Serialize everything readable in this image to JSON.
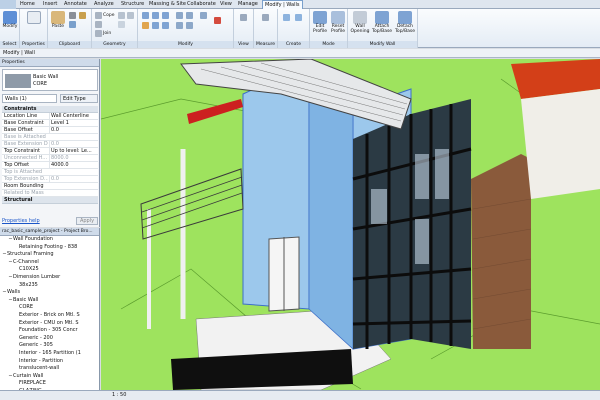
{
  "tabs": [
    "Home",
    "Insert",
    "Annotate",
    "Analyze",
    "Structure",
    "Massing & Site",
    "Collaborate",
    "View",
    "Manage",
    "Modify | Walls"
  ],
  "ribbon": {
    "panels": [
      "Select",
      "Properties",
      "Clipboard",
      "Geometry",
      "Modify",
      "View",
      "Measure",
      "Create",
      "Mode",
      "Modify Wall"
    ],
    "buttons": {
      "modify": "Modify",
      "paste": "Paste",
      "cut_tip": "Cope",
      "join": "Join",
      "edit_profile": "Edit Profile",
      "reset_profile": "Reset Profile",
      "wall_opening": "Wall Opening",
      "attach": "Attach Top/Base",
      "detach": "Detach Top/Base"
    }
  },
  "options_bar": "Modify | Wall",
  "properties": {
    "title": "Properties",
    "type_family": "Basic Wall",
    "type_name": "CORE",
    "selection_filter": "Walls (1)",
    "edit_type": "Edit Type",
    "groups": {
      "constraints": "Constraints",
      "structural": "Structural"
    },
    "rows": [
      {
        "k": "Location Line",
        "v": "Wall Centerline",
        "dim": false
      },
      {
        "k": "Base Constraint",
        "v": "Level 1",
        "dim": false
      },
      {
        "k": "Base Offset",
        "v": "0.0",
        "dim": false
      },
      {
        "k": "Base is Attached",
        "v": "",
        "dim": true
      },
      {
        "k": "Base Extension Di...",
        "v": "0.0",
        "dim": true
      },
      {
        "k": "Top Constraint",
        "v": "Up to level: Le...",
        "dim": false
      },
      {
        "k": "Unconnected H...",
        "v": "8000.0",
        "dim": true
      },
      {
        "k": "Top Offset",
        "v": "4000.0",
        "dim": false
      },
      {
        "k": "Top is Attached",
        "v": "",
        "dim": true
      },
      {
        "k": "Top Extension D...",
        "v": "0.0",
        "dim": true
      },
      {
        "k": "Room Bounding",
        "v": "",
        "dim": false
      },
      {
        "k": "Related to Mass",
        "v": "",
        "dim": true
      }
    ],
    "help": "Properties help",
    "apply": "Apply"
  },
  "browser": {
    "title": "rac_basic_sample_project - Project Bro...",
    "items": [
      {
        "depth": 1,
        "tw": "−",
        "label": "Wall Foundation"
      },
      {
        "depth": 2,
        "tw": "",
        "label": "Retaining Footing - 838"
      },
      {
        "depth": 0,
        "tw": "−",
        "label": "Structural Framing"
      },
      {
        "depth": 1,
        "tw": "−",
        "label": "C-Channel"
      },
      {
        "depth": 2,
        "tw": "",
        "label": "C10X25"
      },
      {
        "depth": 1,
        "tw": "−",
        "label": "Dimension Lumber"
      },
      {
        "depth": 2,
        "tw": "",
        "label": "38x235"
      },
      {
        "depth": 0,
        "tw": "−",
        "label": "Walls"
      },
      {
        "depth": 1,
        "tw": "−",
        "label": "Basic Wall"
      },
      {
        "depth": 2,
        "tw": "",
        "label": "CORE"
      },
      {
        "depth": 2,
        "tw": "",
        "label": "Exterior - Brick on Mtl. S"
      },
      {
        "depth": 2,
        "tw": "",
        "label": "Exterior - CMU on Mtl. S"
      },
      {
        "depth": 2,
        "tw": "",
        "label": "Foundation - 305 Concr"
      },
      {
        "depth": 2,
        "tw": "",
        "label": "Generic - 200"
      },
      {
        "depth": 2,
        "tw": "",
        "label": "Generic - 305"
      },
      {
        "depth": 2,
        "tw": "",
        "label": "Interior - 165 Partition (1"
      },
      {
        "depth": 2,
        "tw": "",
        "label": "Interior - Partition"
      },
      {
        "depth": 2,
        "tw": "",
        "label": "translucent-wall"
      },
      {
        "depth": 1,
        "tw": "−",
        "label": "Curtain Wall"
      },
      {
        "depth": 2,
        "tw": "",
        "label": "FIREPLACE"
      },
      {
        "depth": 2,
        "tw": "",
        "label": "GLAZING"
      }
    ]
  },
  "viewbar": {
    "scale": "1 : 50"
  },
  "colors": {
    "ground": "#9ee35e",
    "selected_wall": "#9cc8ec",
    "accent": "#3d6fc8"
  }
}
